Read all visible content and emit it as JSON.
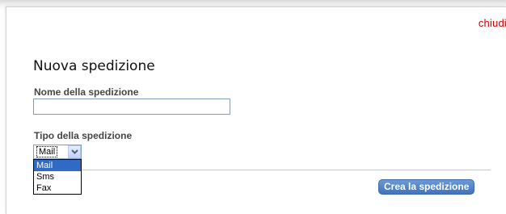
{
  "dialog": {
    "close_label": "chiudi",
    "title": "Nuova spedizione"
  },
  "form": {
    "name_label": "Nome della spedizione",
    "name_value": "",
    "type_label": "Tipo della spedizione",
    "type_selected": "Mail",
    "type_options": [
      "Mail",
      "Sms",
      "Fax"
    ],
    "submit_label": "Crea la spedizione"
  },
  "colors": {
    "close_link": "#cc0000",
    "button_bg": "#4a7cc4",
    "selected_option_bg": "#316ac5",
    "input_border": "#7f9db9"
  },
  "icons": {
    "select_arrow": "chevron-down-icon"
  }
}
